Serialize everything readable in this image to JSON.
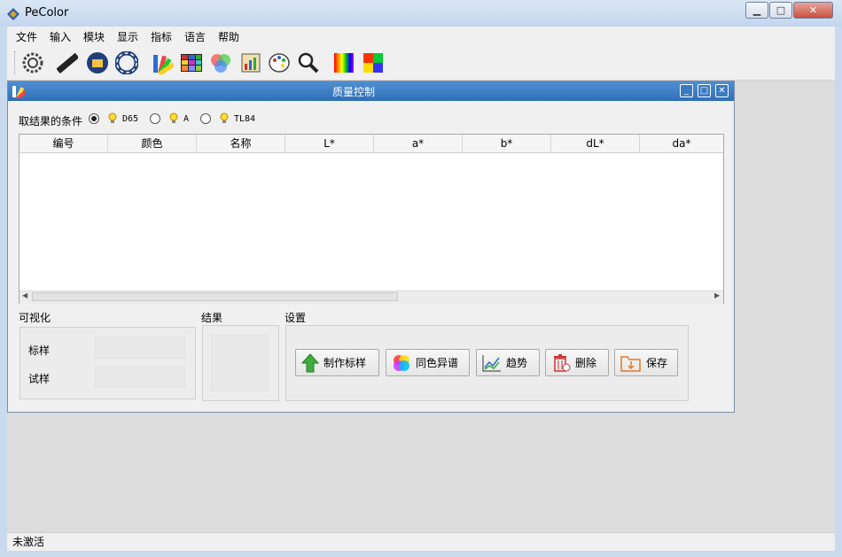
{
  "window": {
    "title": "PeColor",
    "controls": [
      "minimize",
      "maximize",
      "close"
    ]
  },
  "menu": [
    "文件",
    "输入",
    "模块",
    "显示",
    "指标",
    "语言",
    "帮助"
  ],
  "toolbar": {
    "icons": [
      "settings-icon",
      "ruler-icon",
      "folder-open-icon",
      "ring-icon",
      "fan-deck-icon",
      "color-grid-icon",
      "rgb-circles-icon",
      "chart-report-icon",
      "palette-icon",
      "magnifier-icon",
      "spectrum-icon",
      "color-square-icon"
    ]
  },
  "qc_window": {
    "title": "质量控制",
    "condition_label": "取结果的条件",
    "illuminants": [
      {
        "label": "D65",
        "selected": true
      },
      {
        "label": "A",
        "selected": false
      },
      {
        "label": "TL84",
        "selected": false
      }
    ],
    "table_headers": [
      "编号",
      "颜色",
      "名称",
      "L*",
      "a*",
      "b*",
      "dL*",
      "da*"
    ],
    "visual": {
      "label": "可视化",
      "standard_label": "标样",
      "trial_label": "试样"
    },
    "result": {
      "label": "结果"
    },
    "settings": {
      "label": "设置",
      "buttons": [
        "制作标样",
        "同色异谱",
        "趋势",
        "删除",
        "保存"
      ]
    }
  },
  "status": {
    "text": "未激活"
  },
  "colors": {
    "accent": "#2f6fb5",
    "titlebar": "#c3d6ee"
  }
}
